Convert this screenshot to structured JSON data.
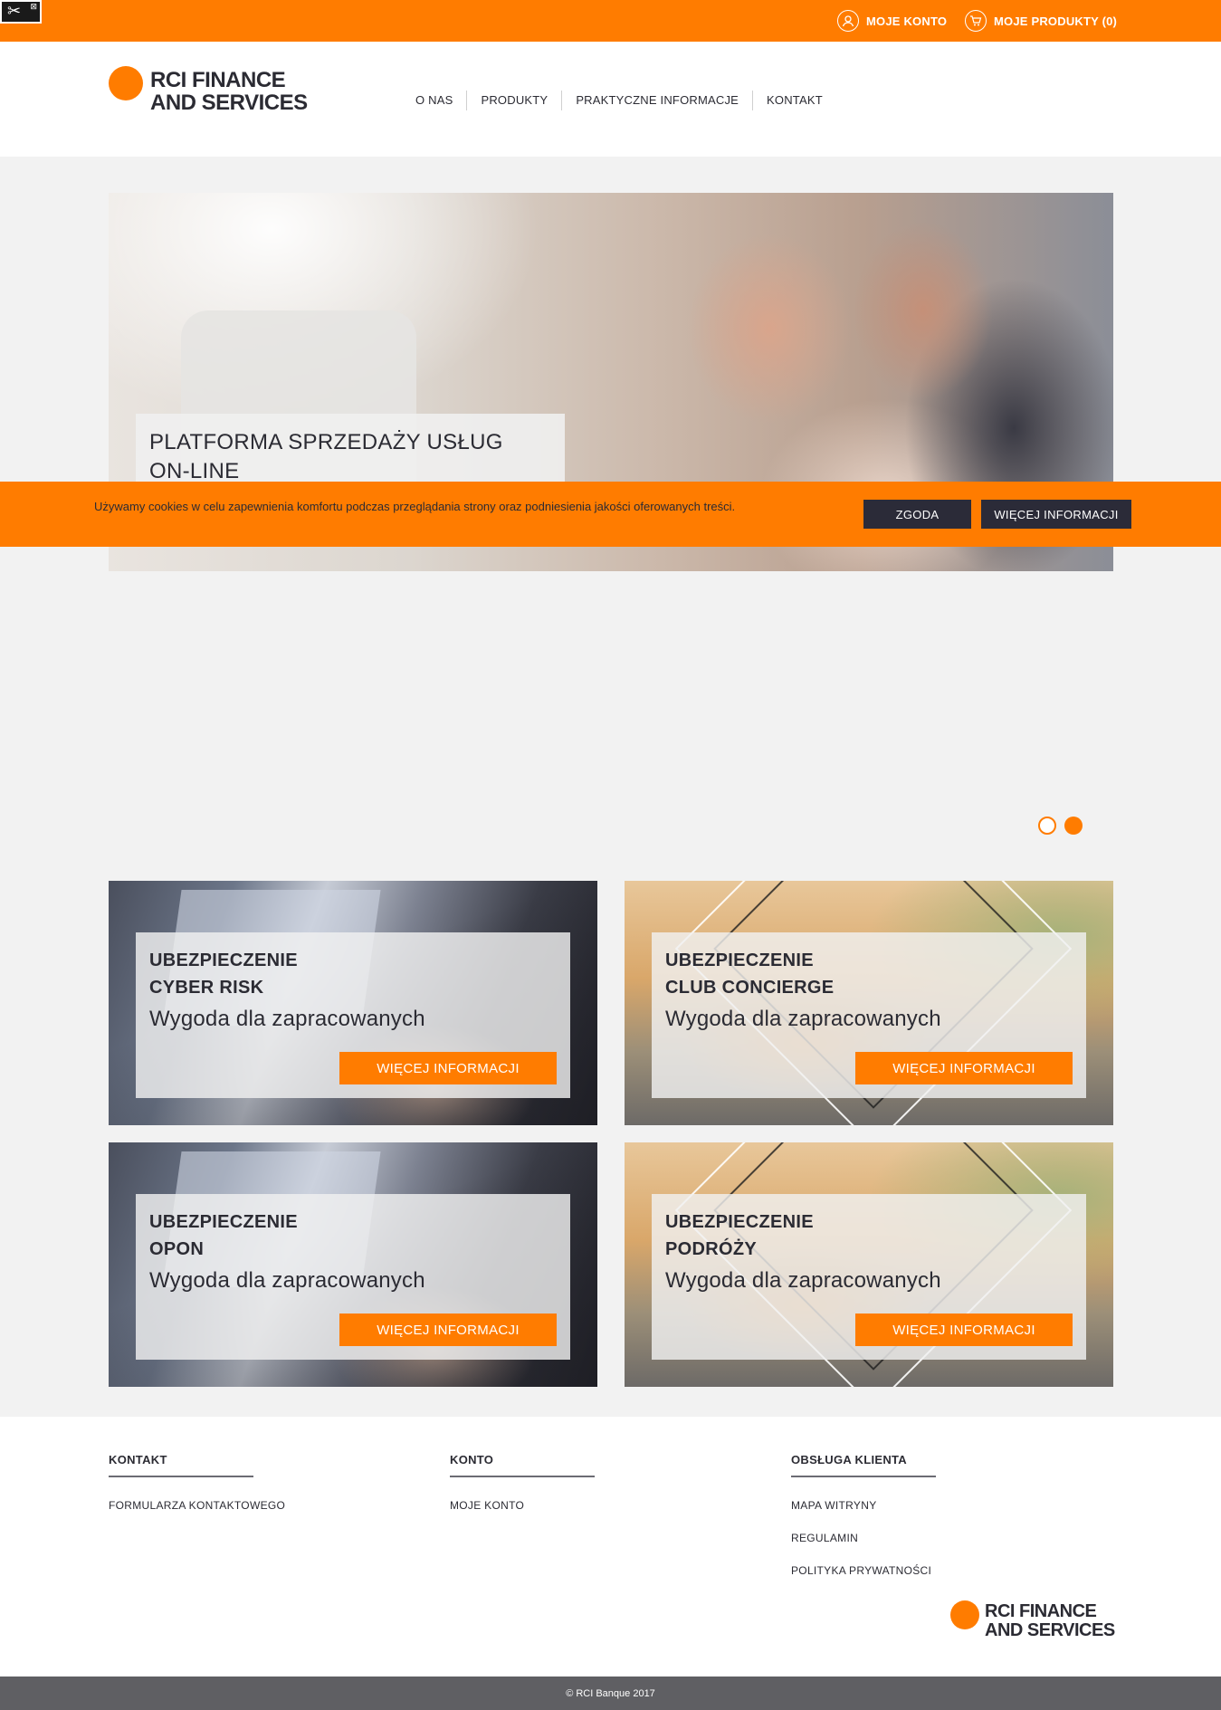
{
  "topbar": {
    "account_label": "MOJE KONTO",
    "products_label": "MOJE PRODUKTY (0)",
    "admin_icon": "tools-icon"
  },
  "brand": {
    "line1": "RCI FINANCE",
    "line2": "AND SERVICES",
    "accent_color": "#ff7c00",
    "dark_color": "#2b2b33"
  },
  "nav": {
    "items": [
      {
        "label": "O NAS"
      },
      {
        "label": "PRODUKTY"
      },
      {
        "label": "PRAKTYCZNE INFORMACJE"
      },
      {
        "label": "KONTAKT"
      }
    ]
  },
  "hero": {
    "caption_line1": "PLATFORMA SPRZEDAŻY USŁUG",
    "caption_line2": "ON-LINE"
  },
  "cookie": {
    "text": "Używamy cookies w celu zapewnienia komfortu podczas przeglądania strony oraz podniesienia jakości oferowanych treści.",
    "agree_label": "ZGODA",
    "more_label": "WIĘCEJ INFORMACJI"
  },
  "slider": {
    "slide_count": 2,
    "active_slide": 2
  },
  "tiles": [
    {
      "title_line1": "UBEZPIECZENIE",
      "title_line2": "CYBER RISK",
      "subtitle": "Wygoda dla zapracowanych",
      "button": "WIĘCEJ INFORMACJI"
    },
    {
      "title_line1": "UBEZPIECZENIE",
      "title_line2": "CLUB CONCIERGE",
      "subtitle": "Wygoda dla zapracowanych",
      "button": "WIĘCEJ INFORMACJI"
    },
    {
      "title_line1": "UBEZPIECZENIE",
      "title_line2": "OPON",
      "subtitle": "Wygoda dla zapracowanych",
      "button": "WIĘCEJ INFORMACJI"
    },
    {
      "title_line1": "UBEZPIECZENIE",
      "title_line2": "PODRÓŻY",
      "subtitle": "Wygoda dla zapracowanych",
      "button": "WIĘCEJ INFORMACJI"
    }
  ],
  "footer": {
    "col1": {
      "heading": "KONTAKT",
      "links": [
        "FORMULARZA KONTAKTOWEGO"
      ]
    },
    "col2": {
      "heading": "KONTO",
      "links": [
        "MOJE KONTO"
      ]
    },
    "col3": {
      "heading": "OBSŁUGA KLIENTA",
      "links": [
        "MAPA WITRYNY",
        "REGULAMIN",
        "POLITYKA PRYWATNOŚCI"
      ]
    },
    "copyright": "© RCI Banque 2017"
  }
}
